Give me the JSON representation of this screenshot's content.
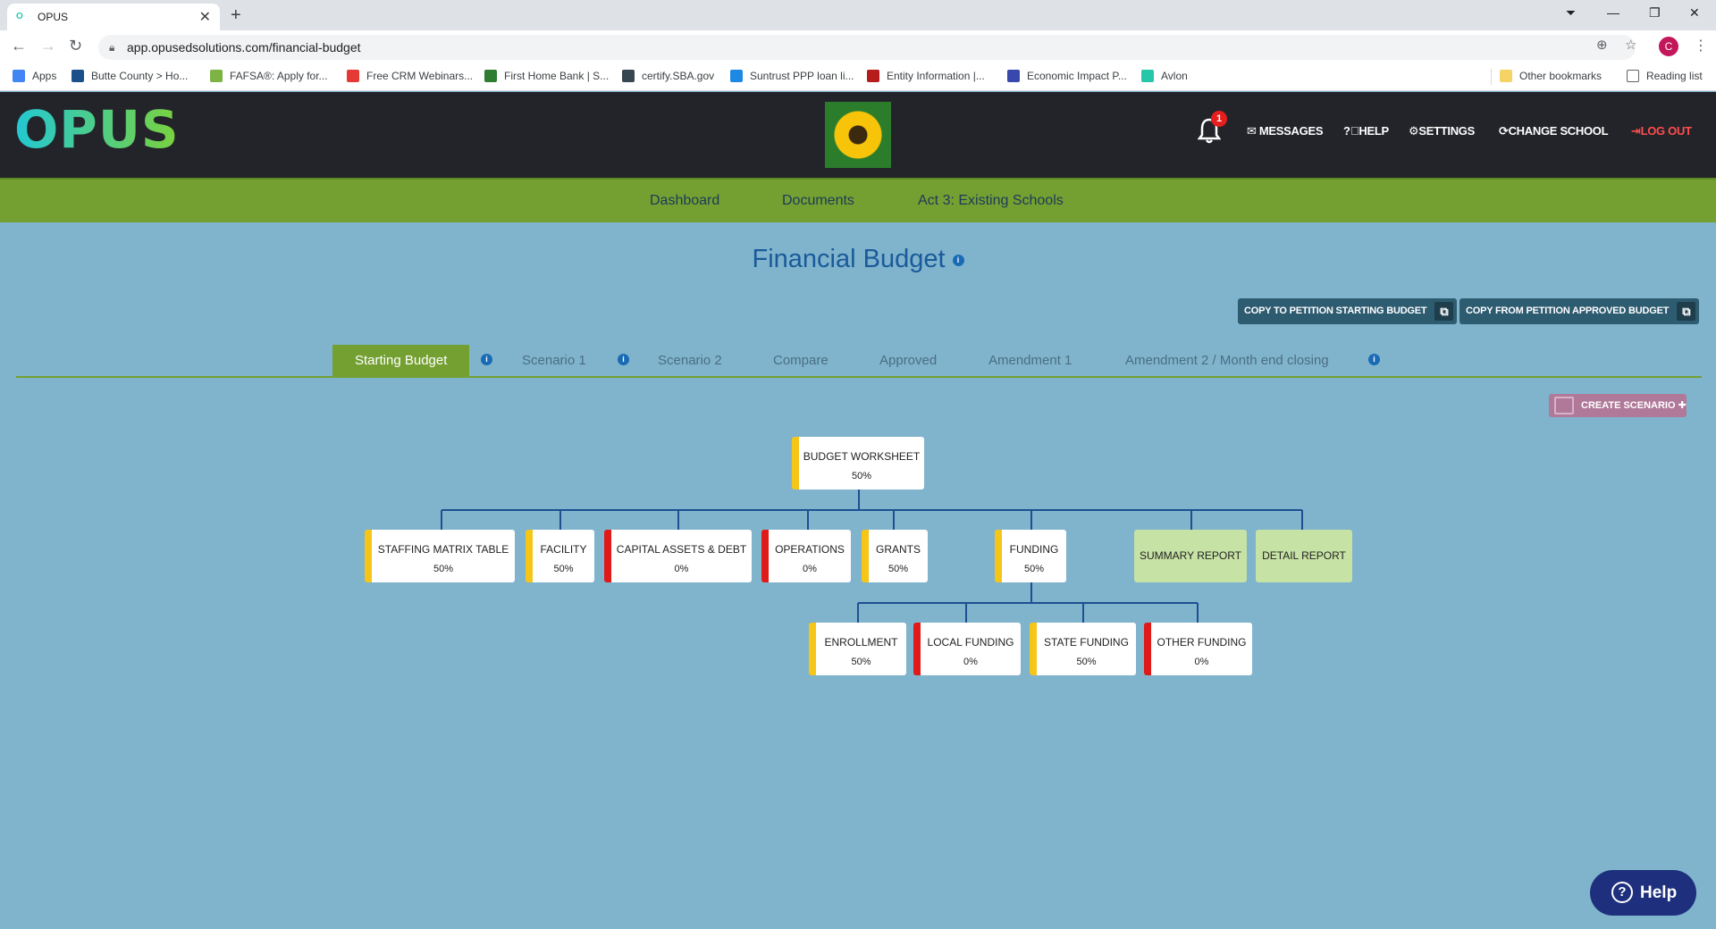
{
  "browser": {
    "tab_title": "OPUS",
    "url": "app.opusedsolutions.com/financial-budget",
    "profile_initial": "C",
    "bookmarks": [
      {
        "label": "Apps",
        "color": "#4285f4"
      },
      {
        "label": "Butte County > Ho...",
        "color": "#1a4f8a"
      },
      {
        "label": "FAFSA®: Apply for...",
        "color": "#7cb342"
      },
      {
        "label": "Free CRM Webinars...",
        "color": "#e53935"
      },
      {
        "label": "First Home Bank | S...",
        "color": "#2e7d32"
      },
      {
        "label": "certify.SBA.gov",
        "color": "#37474f"
      },
      {
        "label": "Suntrust PPP loan li...",
        "color": "#1e88e5"
      },
      {
        "label": "Entity Information |...",
        "color": "#b71c1c"
      },
      {
        "label": "Economic Impact P...",
        "color": "#3949ab"
      },
      {
        "label": "Avlon",
        "color": "#26c6a8"
      }
    ],
    "other_bookmarks": "Other bookmarks",
    "reading_list": "Reading list"
  },
  "header": {
    "logo": "OPUS",
    "notification_count": "1",
    "items": [
      "MESSAGES",
      "HELP",
      "SETTINGS",
      "CHANGE SCHOOL",
      "LOG OUT"
    ]
  },
  "nav": {
    "items": [
      "Dashboard",
      "Documents",
      "Act 3: Existing Schools"
    ]
  },
  "page": {
    "title": "Financial Budget",
    "copy_to_label": "COPY TO PETITION STARTING BUDGET",
    "copy_from_label": "COPY FROM PETITION APPROVED BUDGET",
    "create_scenario_label": "CREATE SCENARIO"
  },
  "budget_tabs": [
    {
      "label": "Starting Budget",
      "active": true
    },
    {
      "label": "Scenario 1"
    },
    {
      "label": "Scenario 2"
    },
    {
      "label": "Compare"
    },
    {
      "label": "Approved"
    },
    {
      "label": "Amendment 1"
    },
    {
      "label": "Amendment 2 / Month end closing"
    }
  ],
  "tree": {
    "root": {
      "label": "BUDGET WORKSHEET",
      "pct": "50%",
      "status": "yellow"
    },
    "level1": [
      {
        "label": "STAFFING MATRIX TABLE",
        "pct": "50%",
        "status": "yellow"
      },
      {
        "label": "FACILITY",
        "pct": "50%",
        "status": "yellow"
      },
      {
        "label": "CAPITAL ASSETS & DEBT",
        "pct": "0%",
        "status": "red"
      },
      {
        "label": "OPERATIONS",
        "pct": "0%",
        "status": "red"
      },
      {
        "label": "GRANTS",
        "pct": "50%",
        "status": "yellow"
      },
      {
        "label": "FUNDING",
        "pct": "50%",
        "status": "yellow"
      },
      {
        "label": "SUMMARY REPORT"
      },
      {
        "label": "DETAIL REPORT"
      }
    ],
    "funding_children": [
      {
        "label": "ENROLLMENT",
        "pct": "50%",
        "status": "yellow"
      },
      {
        "label": "LOCAL FUNDING",
        "pct": "0%",
        "status": "red"
      },
      {
        "label": "STATE FUNDING",
        "pct": "50%",
        "status": "yellow"
      },
      {
        "label": "OTHER FUNDING",
        "pct": "0%",
        "status": "red"
      }
    ]
  },
  "help_button": "Help"
}
